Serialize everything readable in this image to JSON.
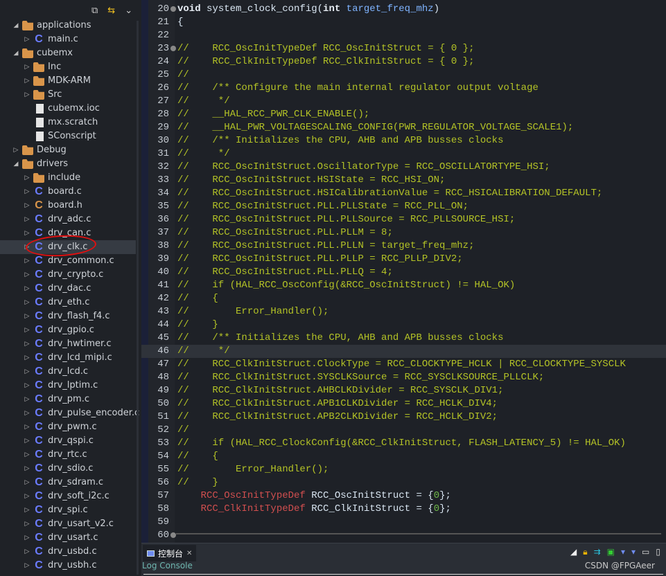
{
  "sidebar": {
    "tools": {
      "collapse": "collapse-all-icon",
      "link": "link-with-editor-icon",
      "menu": "view-menu-icon"
    },
    "items": [
      {
        "label": "applications",
        "level": 0,
        "type": "folder",
        "exp": "open"
      },
      {
        "label": "main.c",
        "level": 1,
        "type": "c",
        "exp": "closed"
      },
      {
        "label": "cubemx",
        "level": 0,
        "type": "folder",
        "exp": "open"
      },
      {
        "label": "Inc",
        "level": 1,
        "type": "folder",
        "exp": "closed"
      },
      {
        "label": "MDK-ARM",
        "level": 1,
        "type": "folder",
        "exp": "closed"
      },
      {
        "label": "Src",
        "level": 1,
        "type": "folder",
        "exp": "closed"
      },
      {
        "label": "cubemx.ioc",
        "level": 1,
        "type": "file",
        "exp": "none"
      },
      {
        "label": "mx.scratch",
        "level": 1,
        "type": "file",
        "exp": "none"
      },
      {
        "label": "SConscript",
        "level": 1,
        "type": "file",
        "exp": "none"
      },
      {
        "label": "Debug",
        "level": 0,
        "type": "folder",
        "exp": "closed"
      },
      {
        "label": "drivers",
        "level": 0,
        "type": "folder",
        "exp": "open"
      },
      {
        "label": "include",
        "level": 1,
        "type": "folder",
        "exp": "closed"
      },
      {
        "label": "board.c",
        "level": 1,
        "type": "c",
        "exp": "closed"
      },
      {
        "label": "board.h",
        "level": 1,
        "type": "h",
        "exp": "closed"
      },
      {
        "label": "drv_adc.c",
        "level": 1,
        "type": "c",
        "exp": "closed"
      },
      {
        "label": "drv_can.c",
        "level": 1,
        "type": "c",
        "exp": "closed"
      },
      {
        "label": "drv_clk.c",
        "level": 1,
        "type": "c",
        "exp": "closed",
        "selected": true
      },
      {
        "label": "drv_common.c",
        "level": 1,
        "type": "c",
        "exp": "closed"
      },
      {
        "label": "drv_crypto.c",
        "level": 1,
        "type": "c",
        "exp": "closed"
      },
      {
        "label": "drv_dac.c",
        "level": 1,
        "type": "c",
        "exp": "closed"
      },
      {
        "label": "drv_eth.c",
        "level": 1,
        "type": "c",
        "exp": "closed"
      },
      {
        "label": "drv_flash_f4.c",
        "level": 1,
        "type": "c",
        "exp": "closed"
      },
      {
        "label": "drv_gpio.c",
        "level": 1,
        "type": "c",
        "exp": "closed"
      },
      {
        "label": "drv_hwtimer.c",
        "level": 1,
        "type": "c",
        "exp": "closed"
      },
      {
        "label": "drv_lcd_mipi.c",
        "level": 1,
        "type": "c",
        "exp": "closed"
      },
      {
        "label": "drv_lcd.c",
        "level": 1,
        "type": "c",
        "exp": "closed"
      },
      {
        "label": "drv_lptim.c",
        "level": 1,
        "type": "c",
        "exp": "closed"
      },
      {
        "label": "drv_pm.c",
        "level": 1,
        "type": "c",
        "exp": "closed"
      },
      {
        "label": "drv_pulse_encoder.c",
        "level": 1,
        "type": "c",
        "exp": "closed"
      },
      {
        "label": "drv_pwm.c",
        "level": 1,
        "type": "c",
        "exp": "closed"
      },
      {
        "label": "drv_qspi.c",
        "level": 1,
        "type": "c",
        "exp": "closed"
      },
      {
        "label": "drv_rtc.c",
        "level": 1,
        "type": "c",
        "exp": "closed"
      },
      {
        "label": "drv_sdio.c",
        "level": 1,
        "type": "c",
        "exp": "closed"
      },
      {
        "label": "drv_sdram.c",
        "level": 1,
        "type": "c",
        "exp": "closed"
      },
      {
        "label": "drv_soft_i2c.c",
        "level": 1,
        "type": "c",
        "exp": "closed"
      },
      {
        "label": "drv_spi.c",
        "level": 1,
        "type": "c",
        "exp": "closed"
      },
      {
        "label": "drv_usart_v2.c",
        "level": 1,
        "type": "c",
        "exp": "closed"
      },
      {
        "label": "drv_usart.c",
        "level": 1,
        "type": "c",
        "exp": "closed"
      },
      {
        "label": "drv_usbd.c",
        "level": 1,
        "type": "c",
        "exp": "closed"
      },
      {
        "label": "drv_usbh.c",
        "level": 1,
        "type": "c",
        "exp": "closed"
      }
    ]
  },
  "editor": {
    "current_line": 46,
    "lines": [
      {
        "n": "20",
        "fold": true,
        "seg": [
          [
            "void",
            "k"
          ],
          [
            " system_clock_config(",
            ""
          ],
          [
            "int",
            "k"
          ],
          [
            " target_freq_mhz",
            "p"
          ],
          [
            ")",
            ""
          ]
        ]
      },
      {
        "n": "21",
        "seg": [
          [
            "{",
            ""
          ]
        ]
      },
      {
        "n": "22",
        "seg": []
      },
      {
        "n": "23",
        "fold": true,
        "seg": [
          [
            "//    RCC_OscInitTypeDef RCC_OscInitStruct = { 0 };",
            "c"
          ]
        ]
      },
      {
        "n": "24",
        "seg": [
          [
            "//    RCC_ClkInitTypeDef RCC_ClkInitStruct = { 0 };",
            "c"
          ]
        ]
      },
      {
        "n": "25",
        "seg": [
          [
            "//",
            "c"
          ]
        ]
      },
      {
        "n": "26",
        "seg": [
          [
            "//    /** Configure the main internal regulator output voltage",
            "c"
          ]
        ]
      },
      {
        "n": "27",
        "seg": [
          [
            "//     */",
            "c"
          ]
        ]
      },
      {
        "n": "28",
        "seg": [
          [
            "//    __HAL_RCC_PWR_CLK_ENABLE();",
            "c"
          ]
        ]
      },
      {
        "n": "29",
        "seg": [
          [
            "//    __HAL_PWR_VOLTAGESCALING_CONFIG(PWR_REGULATOR_VOLTAGE_SCALE1);",
            "c"
          ]
        ]
      },
      {
        "n": "30",
        "seg": [
          [
            "//    /** Initializes the CPU, AHB and APB busses clocks",
            "c"
          ]
        ]
      },
      {
        "n": "31",
        "seg": [
          [
            "//     */",
            "c"
          ]
        ]
      },
      {
        "n": "32",
        "seg": [
          [
            "//    RCC_OscInitStruct.OscillatorType = RCC_OSCILLATORTYPE_HSI;",
            "c"
          ]
        ]
      },
      {
        "n": "33",
        "seg": [
          [
            "//    RCC_OscInitStruct.HSIState = RCC_HSI_ON;",
            "c"
          ]
        ]
      },
      {
        "n": "34",
        "seg": [
          [
            "//    RCC_OscInitStruct.HSICalibrationValue = RCC_HSICALIBRATION_DEFAULT;",
            "c"
          ]
        ]
      },
      {
        "n": "35",
        "seg": [
          [
            "//    RCC_OscInitStruct.PLL.PLLState = RCC_PLL_ON;",
            "c"
          ]
        ]
      },
      {
        "n": "36",
        "seg": [
          [
            "//    RCC_OscInitStruct.PLL.PLLSource = RCC_PLLSOURCE_HSI;",
            "c"
          ]
        ]
      },
      {
        "n": "37",
        "seg": [
          [
            "//    RCC_OscInitStruct.PLL.PLLM = 8;",
            "c"
          ]
        ]
      },
      {
        "n": "38",
        "seg": [
          [
            "//    RCC_OscInitStruct.PLL.PLLN = target_freq_mhz;",
            "c"
          ]
        ]
      },
      {
        "n": "39",
        "seg": [
          [
            "//    RCC_OscInitStruct.PLL.PLLP = RCC_PLLP_DIV2;",
            "c"
          ]
        ]
      },
      {
        "n": "40",
        "seg": [
          [
            "//    RCC_OscInitStruct.PLL.PLLQ = 4;",
            "c"
          ]
        ]
      },
      {
        "n": "41",
        "seg": [
          [
            "//    if (HAL_RCC_OscConfig(&RCC_OscInitStruct) != HAL_OK)",
            "c"
          ]
        ]
      },
      {
        "n": "42",
        "seg": [
          [
            "//    {",
            "c"
          ]
        ]
      },
      {
        "n": "43",
        "seg": [
          [
            "//        Error_Handler();",
            "c"
          ]
        ]
      },
      {
        "n": "44",
        "seg": [
          [
            "//    }",
            "c"
          ]
        ]
      },
      {
        "n": "45",
        "seg": [
          [
            "//    /** Initializes the CPU, AHB and APB busses clocks",
            "c"
          ]
        ]
      },
      {
        "n": "46",
        "seg": [
          [
            "//     */",
            "c"
          ]
        ]
      },
      {
        "n": "47",
        "seg": [
          [
            "//    RCC_ClkInitStruct.ClockType = RCC_CLOCKTYPE_HCLK | RCC_CLOCKTYPE_SYSCLK",
            "c"
          ]
        ]
      },
      {
        "n": "48",
        "seg": [
          [
            "//    RCC_ClkInitStruct.SYSCLKSource = RCC_SYSCLKSOURCE_PLLCLK;",
            "c"
          ]
        ]
      },
      {
        "n": "49",
        "seg": [
          [
            "//    RCC_ClkInitStruct.AHBCLKDivider = RCC_SYSCLK_DIV1;",
            "c"
          ]
        ]
      },
      {
        "n": "50",
        "seg": [
          [
            "//    RCC_ClkInitStruct.APB1CLKDivider = RCC_HCLK_DIV4;",
            "c"
          ]
        ]
      },
      {
        "n": "51",
        "seg": [
          [
            "//    RCC_ClkInitStruct.APB2CLKDivider = RCC_HCLK_DIV2;",
            "c"
          ]
        ]
      },
      {
        "n": "52",
        "seg": [
          [
            "//",
            "c"
          ]
        ]
      },
      {
        "n": "53",
        "seg": [
          [
            "//    if (HAL_RCC_ClockConfig(&RCC_ClkInitStruct, FLASH_LATENCY_5) != HAL_OK)",
            "c"
          ]
        ]
      },
      {
        "n": "54",
        "seg": [
          [
            "//    {",
            "c"
          ]
        ]
      },
      {
        "n": "55",
        "seg": [
          [
            "//        Error_Handler();",
            "c"
          ]
        ]
      },
      {
        "n": "56",
        "seg": [
          [
            "//    }",
            "c"
          ]
        ]
      },
      {
        "n": "57",
        "seg": [
          [
            "    ",
            ""
          ],
          [
            "RCC_OscInitTypeDef",
            "t"
          ],
          [
            " RCC_OscInitStruct = {",
            ""
          ],
          [
            "0",
            "num"
          ],
          [
            "};",
            ""
          ]
        ]
      },
      {
        "n": "58",
        "seg": [
          [
            "    ",
            ""
          ],
          [
            "RCC_ClkInitTypeDef",
            "t"
          ],
          [
            " RCC_ClkInitStruct = {",
            ""
          ],
          [
            "0",
            "num"
          ],
          [
            "};",
            ""
          ]
        ]
      },
      {
        "n": "59",
        "seg": []
      },
      {
        "n": "60",
        "fold": true,
        "seg": []
      }
    ]
  },
  "console": {
    "tab_label": "控制台",
    "close": "✕",
    "log_label": "Log Console",
    "watermark": "CSDN @FPGAeer",
    "tools": [
      "clear-console-icon",
      "scroll-lock-icon",
      "word-wrap-icon",
      "pin-console-icon",
      "display-console-icon",
      "new-console-icon",
      "minimize-icon",
      "maximize-icon"
    ]
  },
  "colors": {
    "comment": "#b4c326",
    "type": "#d24f4f",
    "number": "#6fb84a",
    "annotation": "#e01010"
  }
}
